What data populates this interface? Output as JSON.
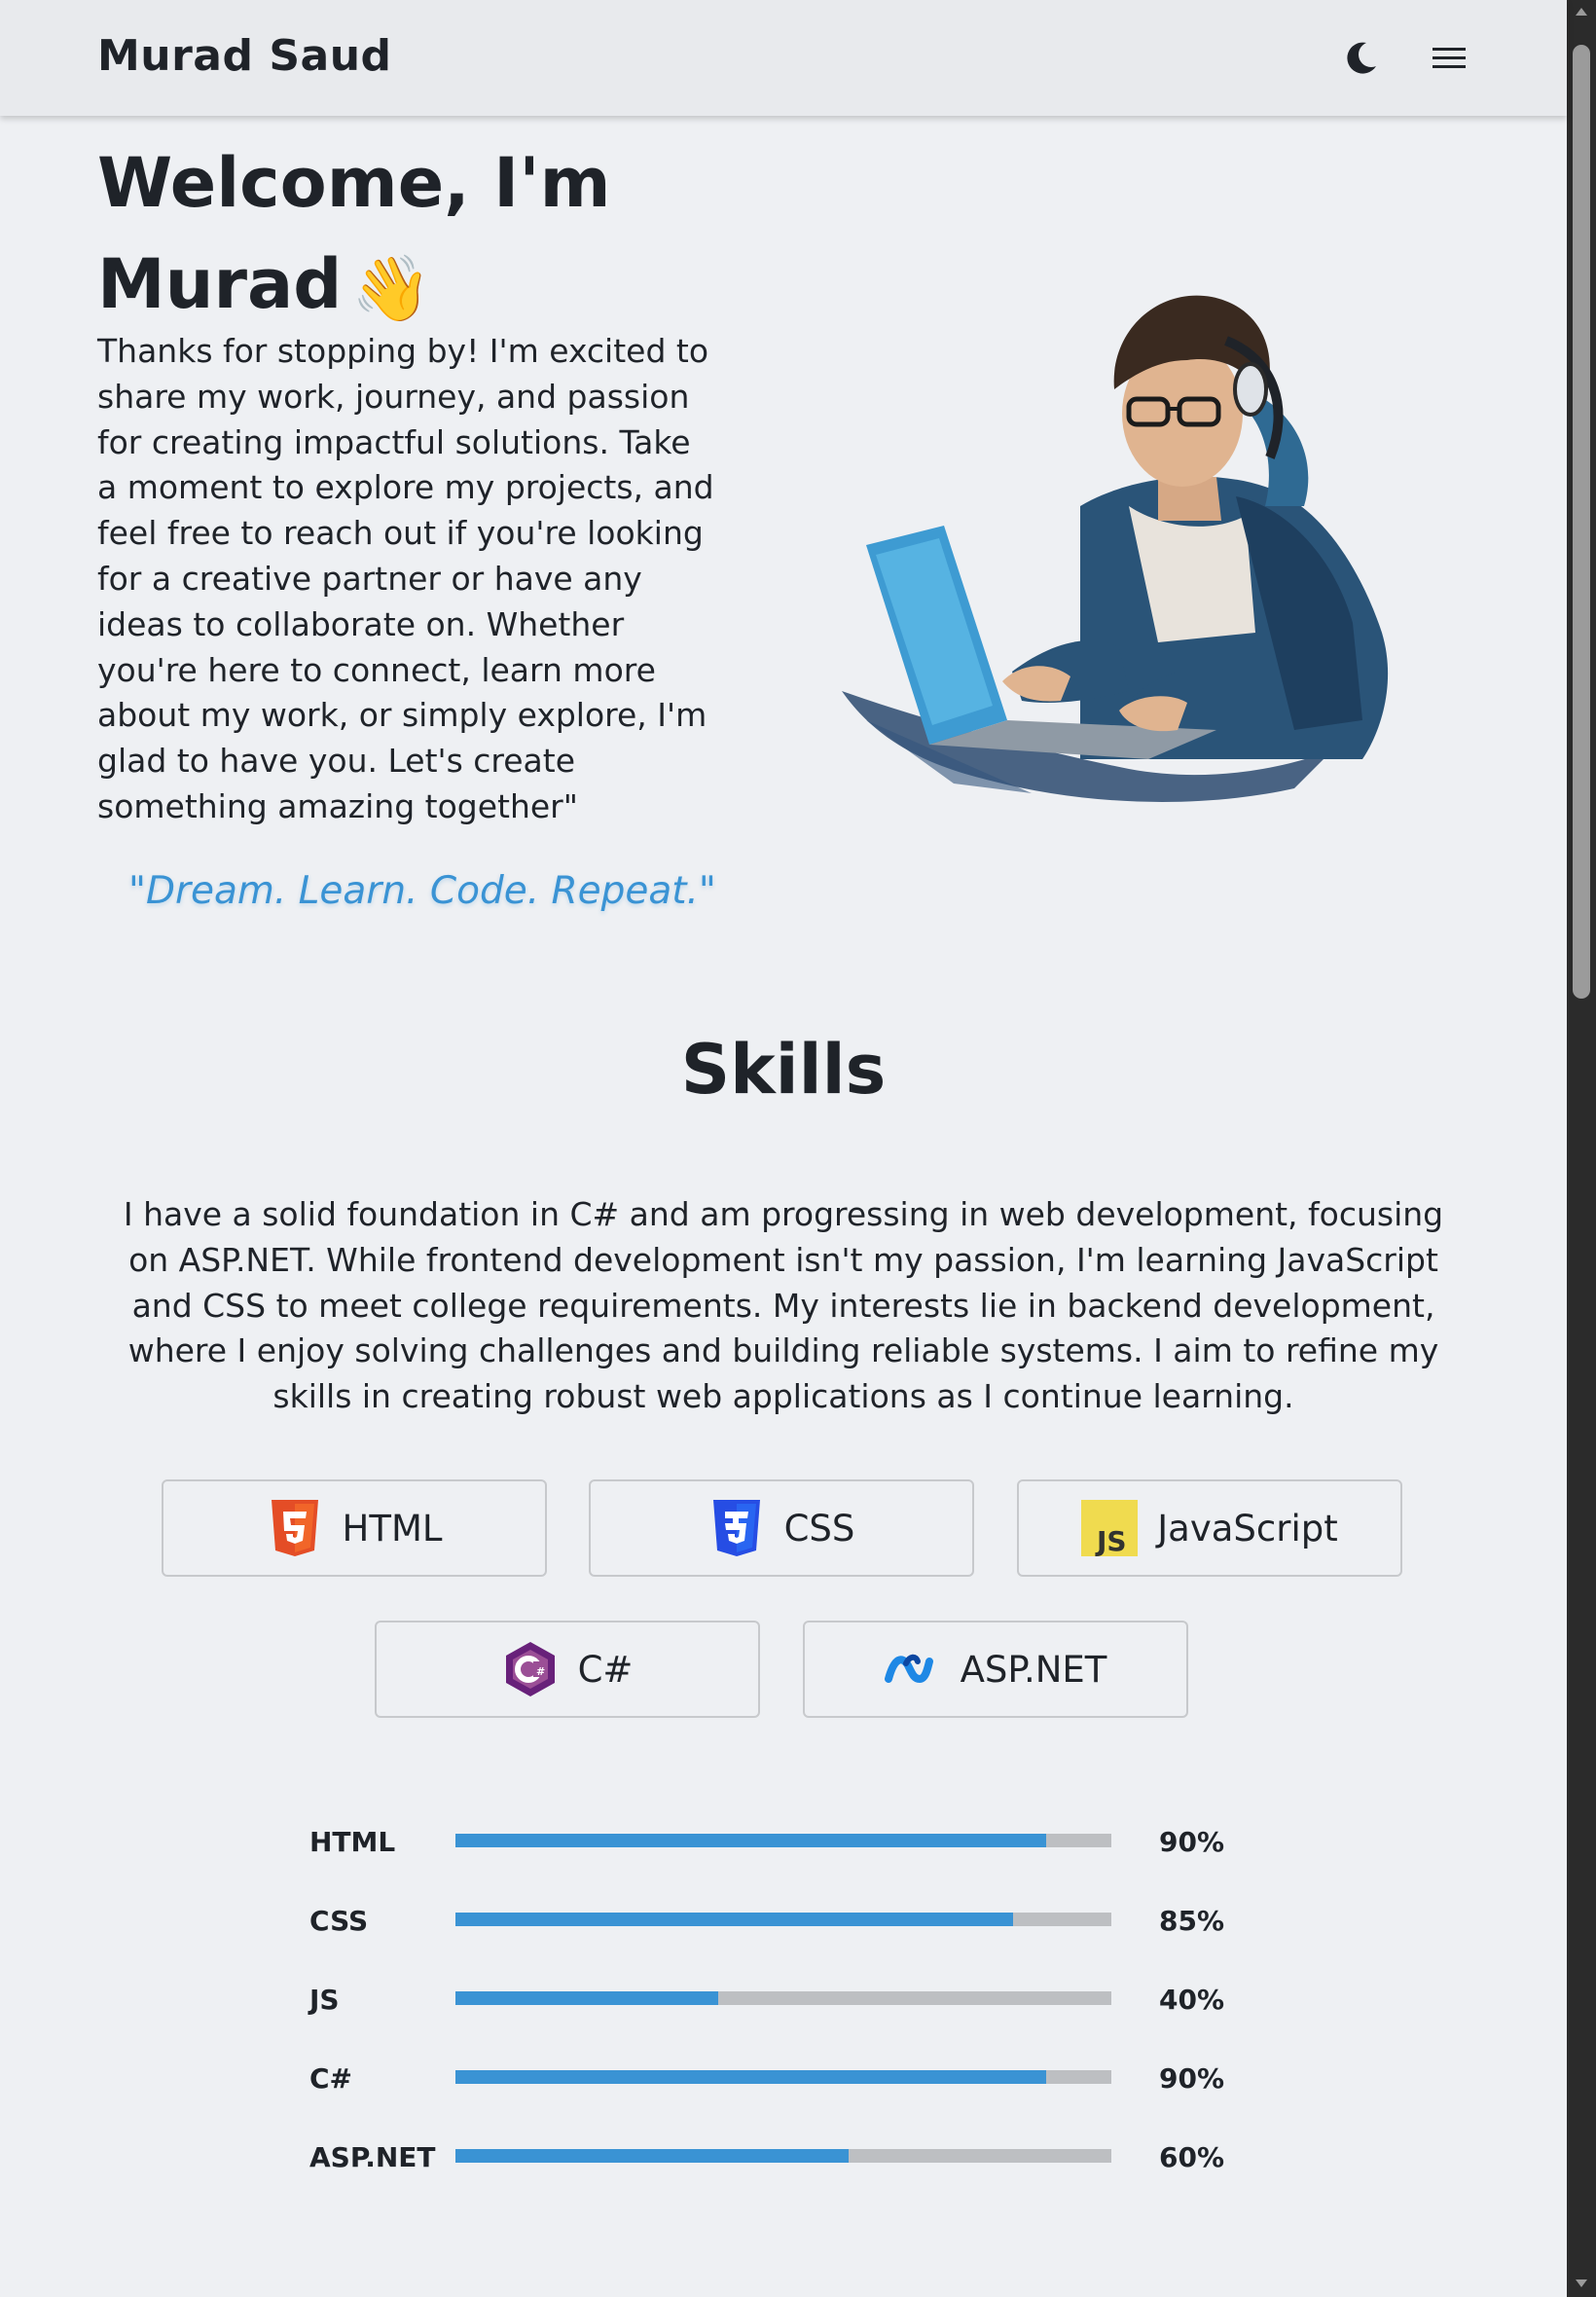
{
  "header": {
    "brand": "Murad Saud",
    "theme_toggle_icon": "moon-icon",
    "menu_icon": "hamburger-menu-icon"
  },
  "hero": {
    "title": "Welcome, I'm Murad",
    "wave_emoji": "👋",
    "intro": "Thanks for stopping by! I'm excited to share my work, journey, and passion for creating impactful solutions. Take a moment to explore my projects, and feel free to reach out if you're looking for a creative partner or have any ideas to collaborate on. Whether you're here to connect, learn more about my work, or simply explore, I'm glad to have you. Let's create something amazing together\"",
    "quote": "\"Dream. Learn. Code. Repeat.\"",
    "image": "developer-illustration"
  },
  "skills": {
    "heading": "Skills",
    "description": "I have a solid foundation in C# and am progressing in web development, focusing on ASP.NET. While frontend development isn't my passion, I'm learning JavaScript and CSS to meet college requirements. My interests lie in backend development, where I enjoy solving challenges and building reliable systems. I aim to refine my skills in creating robust web applications as I continue learning.",
    "cards": [
      {
        "label": "HTML",
        "icon": "html5-icon",
        "color": "#e44d26"
      },
      {
        "label": "CSS",
        "icon": "css3-icon",
        "color": "#264de4"
      },
      {
        "label": "JavaScript",
        "icon": "javascript-icon",
        "color": "#f0db4f"
      },
      {
        "label": "C#",
        "icon": "csharp-icon",
        "color": "#68217a"
      },
      {
        "label": "ASP.NET",
        "icon": "dotnet-icon",
        "color": "#1e88e5"
      }
    ],
    "levels": [
      {
        "label": "HTML",
        "value_text": "90%",
        "fraction": 0.9
      },
      {
        "label": "CSS",
        "value_text": "85%",
        "fraction": 0.85
      },
      {
        "label": "JS",
        "value_text": "40%",
        "fraction": 0.4
      },
      {
        "label": "C#",
        "value_text": "90%",
        "fraction": 0.9
      },
      {
        "label": "ASP.NET",
        "value_text": "60%",
        "fraction": 0.6
      }
    ]
  },
  "colors": {
    "accent": "#3a93d4",
    "background": "#eef0f3",
    "header": "#e8eaed",
    "track": "#bdbfc2"
  }
}
